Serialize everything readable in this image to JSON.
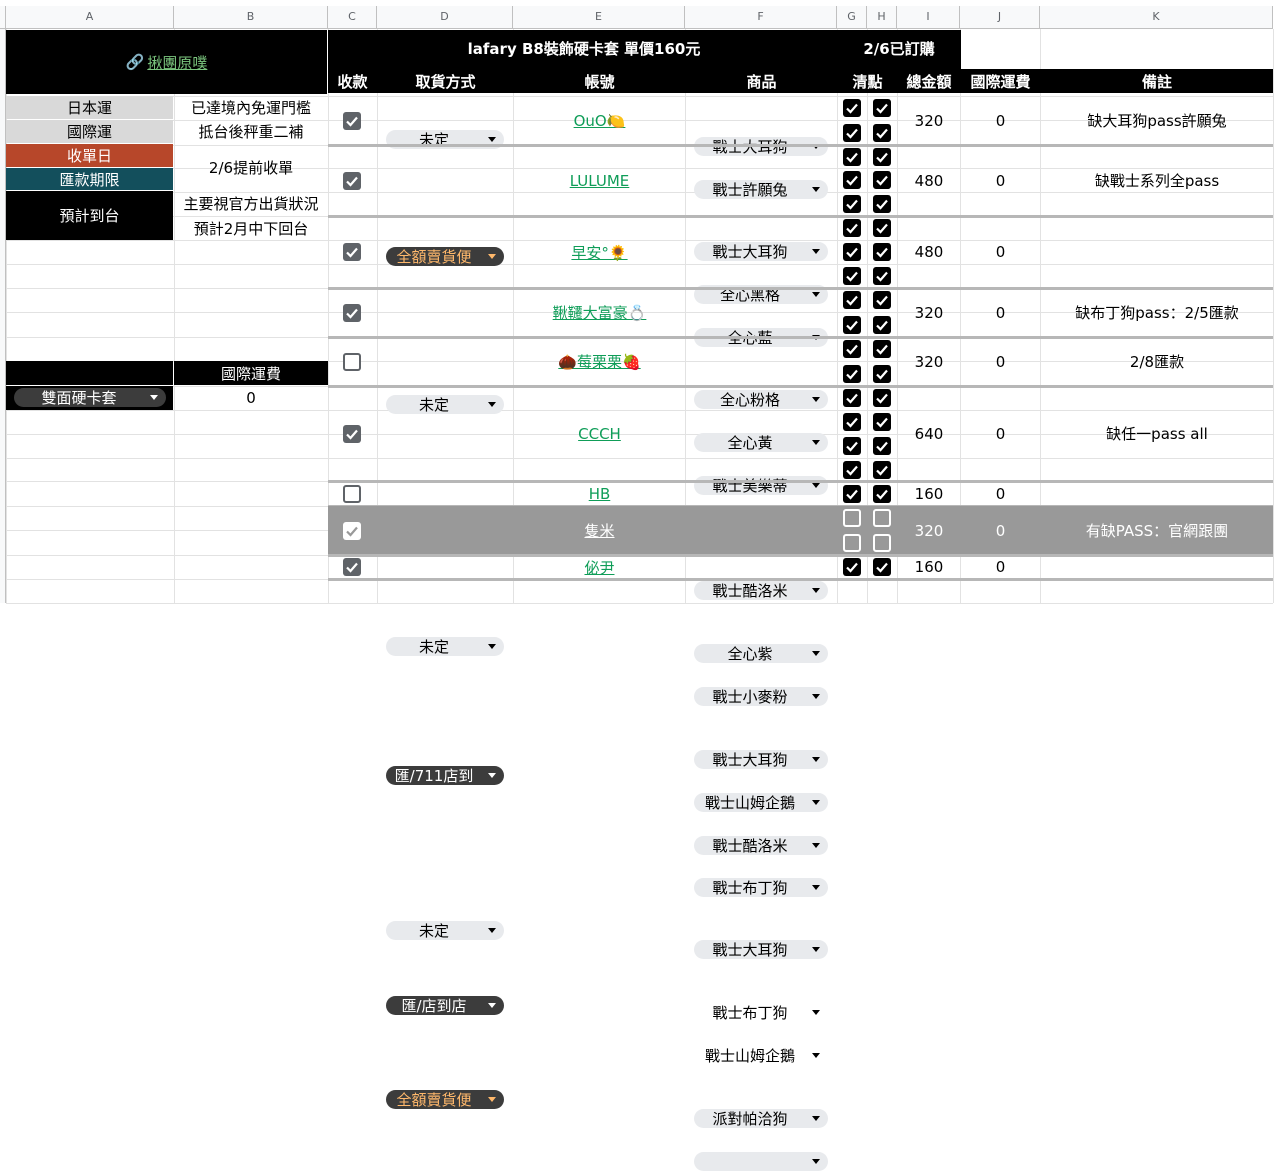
{
  "columns": [
    "A",
    "B",
    "C",
    "D",
    "E",
    "F",
    "G",
    "H",
    "I",
    "J",
    "K"
  ],
  "colors": {
    "ship_jp": "#d9d9d9",
    "order_day": "#b7472a",
    "pay_deadline": "#134f5c",
    "header": "#000000",
    "highlight_row": "#999999",
    "account_green": "#0f9d58"
  },
  "left": {
    "link_text": "揪團原噗",
    "info": [
      {
        "label": "日本運",
        "value": "已達境內免運門檻"
      },
      {
        "label": "國際運",
        "value": "抵台後秤重二補"
      },
      {
        "label": "收單日",
        "value": "2/6提前收單"
      },
      {
        "label": "匯款期限",
        "value": ""
      },
      {
        "label": "預計到台",
        "value": "主要視官方出貨狀況",
        "value2": "預計2月中下回台"
      }
    ],
    "shipping_header": "國際運費",
    "shipping_option": "雙面硬卡套",
    "shipping_value": "0"
  },
  "header": {
    "title": "lafary B8裝飾硬卡套 單價160元",
    "status": "2/6已訂購",
    "cols": {
      "paid": "收款",
      "pickup": "取貨方式",
      "account": "帳號",
      "item": "商品",
      "check": "清點",
      "total": "總金額",
      "intl": "國際運費",
      "note": "備註"
    }
  },
  "orders": [
    {
      "paid": true,
      "pickup": "未定",
      "pickup_style": "grey",
      "account": "OuO🍋",
      "items": [
        {
          "name": "戰士大耳狗",
          "g": true,
          "h": true
        },
        {
          "name": "戰士許願兔",
          "g": true,
          "h": true
        }
      ],
      "total": "320",
      "intl": "0",
      "note": "缺大耳狗pass許願兔"
    },
    {
      "paid": true,
      "pickup": "全額賣貨便",
      "pickup_style": "orange",
      "account": "LULUME",
      "items": [
        {
          "name": "戰士大耳狗",
          "g": true,
          "h": true
        },
        {
          "name": "全心黑格",
          "g": true,
          "h": true
        },
        {
          "name": "全心藍",
          "g": true,
          "h": true
        }
      ],
      "total": "480",
      "intl": "0",
      "note": "缺戰士系列全pass"
    },
    {
      "paid": true,
      "pickup": "未定",
      "pickup_style": "grey",
      "account": "早安°🌻",
      "items": [
        {
          "name": "全心粉格",
          "g": true,
          "h": true
        },
        {
          "name": "全心黃",
          "g": true,
          "h": true
        },
        {
          "name": "戰士美樂蒂",
          "g": true,
          "h": true
        }
      ],
      "total": "480",
      "intl": "0",
      "note": ""
    },
    {
      "paid": true,
      "pickup": "未定",
      "pickup_style": "grey",
      "account": "鞦韆大富豪💍",
      "items": [
        {
          "name": "戰士布丁狗",
          "g": true,
          "h": true
        },
        {
          "name": "戰士酷洛米",
          "g": true,
          "h": true
        }
      ],
      "total": "320",
      "intl": "0",
      "note": "缺布丁狗pass：2/5匯款"
    },
    {
      "paid": false,
      "pickup": "未定",
      "pickup_style": "grey",
      "account": "🌰莓栗栗🍓",
      "items": [
        {
          "name": "全心紫",
          "g": true,
          "h": true
        },
        {
          "name": "戰士小麥粉",
          "g": true,
          "h": true
        }
      ],
      "total": "320",
      "intl": "0",
      "note": "2/8匯款"
    },
    {
      "paid": true,
      "pickup": "匯/711店到",
      "pickup_style": "dark",
      "account": "CCCH",
      "items": [
        {
          "name": "戰士大耳狗",
          "g": true,
          "h": true
        },
        {
          "name": "戰士山姆企鵝",
          "g": true,
          "h": true
        },
        {
          "name": "戰士酷洛米",
          "g": true,
          "h": true
        },
        {
          "name": "戰士布丁狗",
          "g": true,
          "h": true
        }
      ],
      "total": "640",
      "intl": "0",
      "note": "缺任一pass all"
    },
    {
      "paid": false,
      "pickup": "未定",
      "pickup_style": "grey",
      "account": "HB",
      "items": [
        {
          "name": "戰士大耳狗",
          "g": true,
          "h": true
        }
      ],
      "total": "160",
      "intl": "0",
      "note": ""
    },
    {
      "paid": true,
      "pickup": "匯/店到店",
      "pickup_style": "dark",
      "account": "隻米",
      "highlight": true,
      "items": [
        {
          "name": "戰士布丁狗",
          "g": false,
          "h": false
        },
        {
          "name": "戰士山姆企鵝",
          "g": false,
          "h": false
        }
      ],
      "total": "320",
      "intl": "0",
      "note": "有缺PASS：官網跟團"
    },
    {
      "paid": true,
      "pickup": "全額賣貨便",
      "pickup_style": "orange",
      "account": "佖尹",
      "items": [
        {
          "name": "派對帕洽狗",
          "g": true,
          "h": true
        }
      ],
      "total": "160",
      "intl": "0",
      "note": ""
    },
    {
      "paid": null,
      "pickup": "",
      "pickup_style": "none",
      "account": "",
      "items": [
        {
          "name": "",
          "g": null,
          "h": null
        }
      ],
      "total": "",
      "intl": "",
      "note": ""
    }
  ]
}
